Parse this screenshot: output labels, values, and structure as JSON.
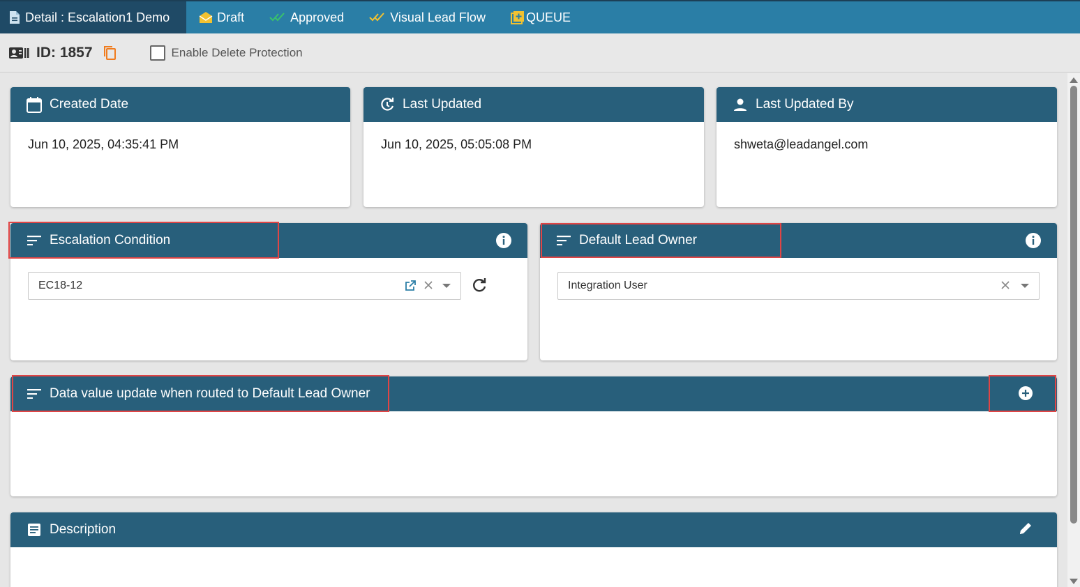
{
  "tabs": [
    {
      "label": "Detail : Escalation1 Demo",
      "icon": "document-icon",
      "active": true
    },
    {
      "label": "Draft",
      "icon": "envelope-icon"
    },
    {
      "label": "Approved",
      "icon": "double-check-icon"
    },
    {
      "label": "Visual Lead Flow",
      "icon": "double-check-icon"
    },
    {
      "label": "QUEUE",
      "icon": "queue-add-icon"
    }
  ],
  "header": {
    "id_text": "ID: 1857",
    "delete_protection_label": "Enable Delete Protection",
    "delete_protection_checked": false
  },
  "info_cards": [
    {
      "title": "Created Date",
      "value": "Jun 10, 2025, 04:35:41 PM",
      "icon": "calendar-icon"
    },
    {
      "title": "Last Updated",
      "value": "Jun 10, 2025, 05:05:08 PM",
      "icon": "refresh-clock-icon"
    },
    {
      "title": "Last Updated By",
      "value": "shweta@leadangel.com",
      "icon": "person-icon"
    }
  ],
  "escalation": {
    "title": "Escalation Condition",
    "value": "EC18-12"
  },
  "default_owner": {
    "title": "Default Lead Owner",
    "value": "Integration User"
  },
  "data_update": {
    "title": "Data value update when routed to Default Lead Owner"
  },
  "description": {
    "title": "Description"
  },
  "colors": {
    "tab_bar": "#2a7ea6",
    "tab_active": "#1f4a66",
    "card_header": "#285f7b",
    "highlight": "#e04545",
    "copy_icon": "#f07c1e",
    "check_green": "#39c26b",
    "check_yellow": "#f2c230"
  }
}
